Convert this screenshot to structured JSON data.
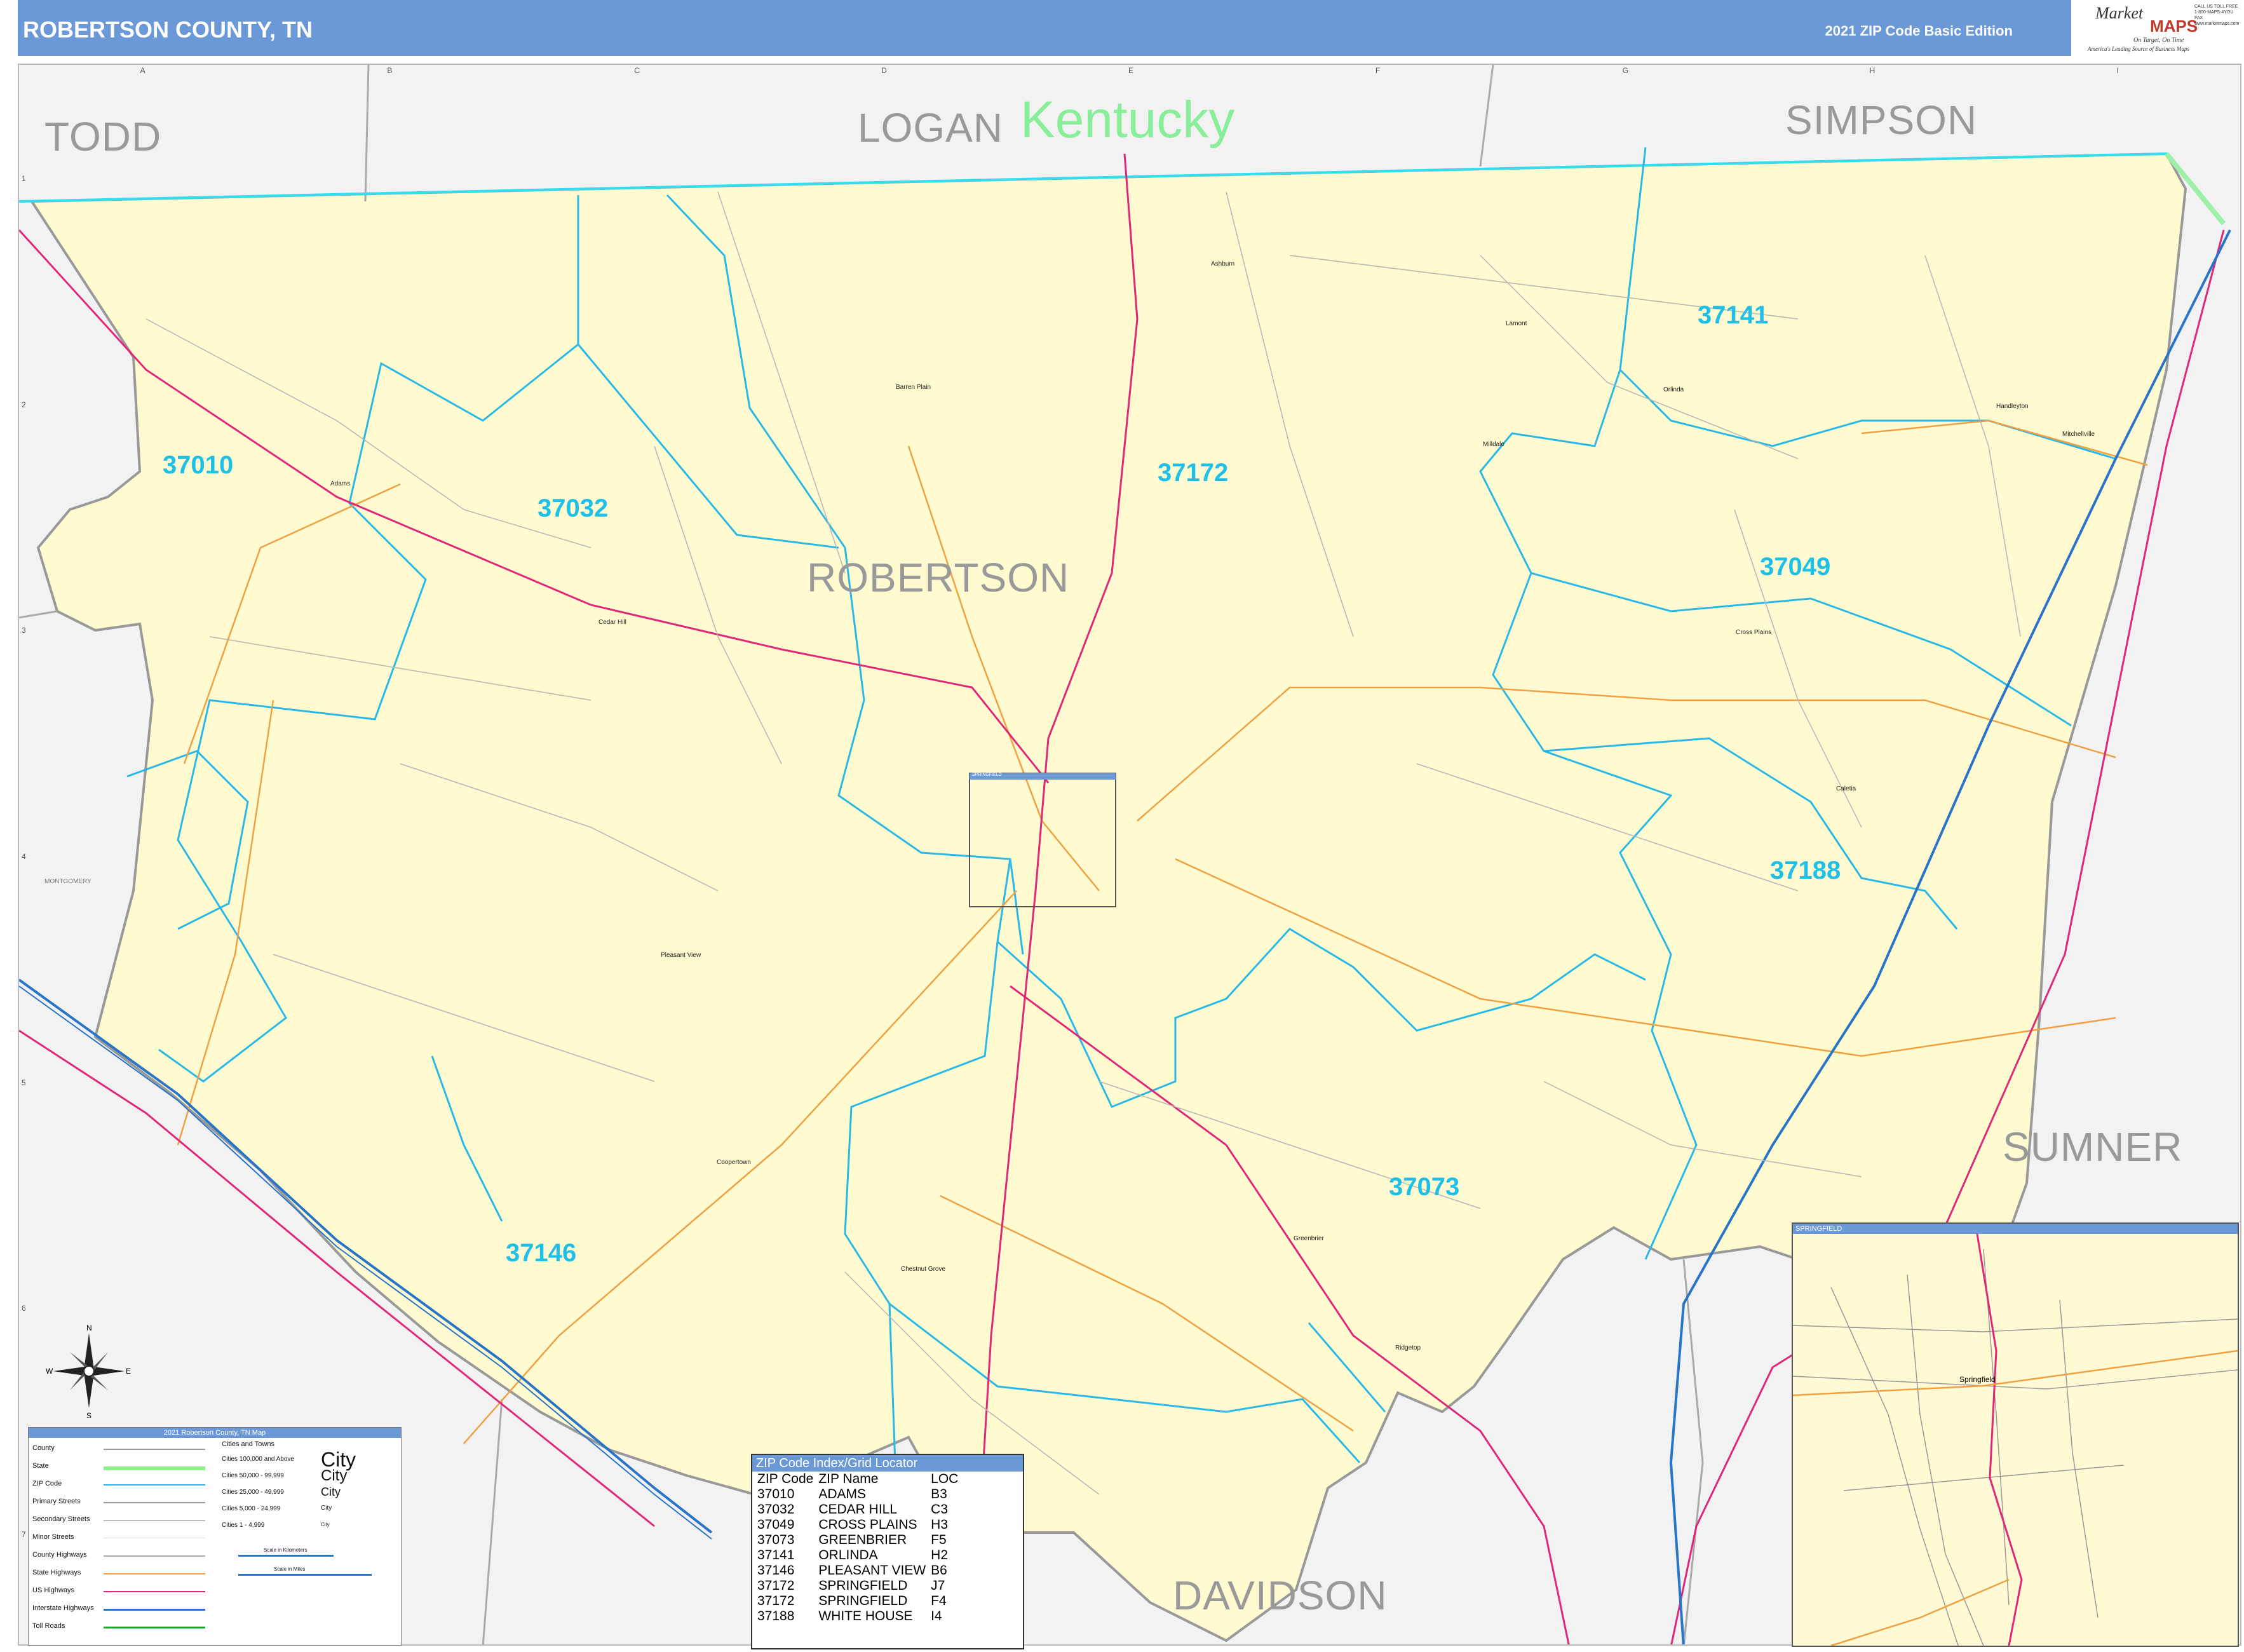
{
  "header": {
    "title": "ROBERTSON COUNTY, TN",
    "edition": "2021 ZIP Code Basic Edition",
    "logo_word1": "Market",
    "logo_word2": "MAPS",
    "logo_tagline": "On Target, On Time",
    "logo_subtag": "America's Leading Source of Business Maps",
    "contact": "CALL US TOLL FREE 1-800-MAPS-4YOU FAX www.marketmaps.com"
  },
  "grid": {
    "columns": [
      "A",
      "B",
      "C",
      "D",
      "E",
      "F",
      "G",
      "H",
      "I"
    ],
    "rows": [
      "1",
      "2",
      "3",
      "4",
      "5",
      "6",
      "7"
    ]
  },
  "labels": {
    "counties": {
      "todd": "TODD",
      "logan": "LOGAN",
      "simpson": "SIMPSON",
      "robertson": "ROBERTSON",
      "sumner": "SUMNER",
      "davidson": "DAVIDSON",
      "montgomery": "MONTGOMERY"
    },
    "state": "Kentucky",
    "zips": [
      "37010",
      "37032",
      "37172",
      "37141",
      "37049",
      "37188",
      "37073",
      "37146"
    ],
    "towns": {
      "adams": "Adams",
      "cedar_hill": "Cedar Hill",
      "barren_plain": "Barren Plain",
      "ashburn": "Ashburn",
      "lamont": "Lamont",
      "orlinda": "Orlinda",
      "mitchellville": "Mitchellville",
      "millstone": "Milldale",
      "cross_plains": "Cross Plains",
      "coopertown": "Coopertown",
      "pleasant_view": "Pleasant View",
      "greenbrier": "Greenbrier",
      "ridgetop": "Ridgetop",
      "chestnut_grove": "Chestnut Grove",
      "caletia": "Caletia",
      "springfield": "Springfield",
      "handleyton": "Handleyton"
    }
  },
  "legend": {
    "title": "2021 Robertson County, TN Map",
    "items": [
      "County",
      "State",
      "ZIP Code",
      "Primary Streets",
      "Secondary Streets",
      "Minor Streets",
      "County Highways",
      "State Highways",
      "US Highways",
      "Interstate Highways",
      "Toll Roads"
    ],
    "cities_header": "Cities and Towns",
    "city_classes": [
      "Cities 100,000 and Above",
      "Cities 50,000 - 99,999",
      "Cities 25,000 - 49,999",
      "Cities 5,000 - 24,999",
      "Cities 1 - 4,999"
    ],
    "city_samples": [
      "City",
      "City",
      "City",
      "City",
      "City"
    ],
    "scale_km": "Scale in Kilometers",
    "scale_mi": "Scale in Miles",
    "colors": {
      "county": "#999999",
      "state": "#90ee90",
      "zip": "#2ab9e6",
      "county_hwy": "#aaaaaa",
      "state_hwy": "#f0a040",
      "us_hwy": "#e0287a",
      "interstate": "#2874c8",
      "toll": "#22aa33"
    }
  },
  "zip_index": {
    "title": "ZIP Code Index/Grid Locator",
    "headers": [
      "ZIP Code",
      "ZIP Name",
      "LOC"
    ],
    "rows": [
      [
        "37010",
        "ADAMS",
        "B3"
      ],
      [
        "37032",
        "CEDAR HILL",
        "C3"
      ],
      [
        "37049",
        "CROSS PLAINS",
        "H3"
      ],
      [
        "37073",
        "GREENBRIER",
        "F5"
      ],
      [
        "37141",
        "ORLINDA",
        "H2"
      ],
      [
        "37146",
        "PLEASANT VIEW",
        "B6"
      ],
      [
        "37172",
        "SPRINGFIELD",
        "J7"
      ],
      [
        "37172",
        "SPRINGFIELD",
        "F4"
      ],
      [
        "37188",
        "WHITE HOUSE",
        "I4"
      ]
    ]
  },
  "inset": {
    "title": "SPRINGFIELD",
    "city_label": "Springfield"
  },
  "small_inset_label": "SPRINGFIELD",
  "compass": {
    "n": "N",
    "s": "S",
    "e": "E",
    "w": "W"
  }
}
